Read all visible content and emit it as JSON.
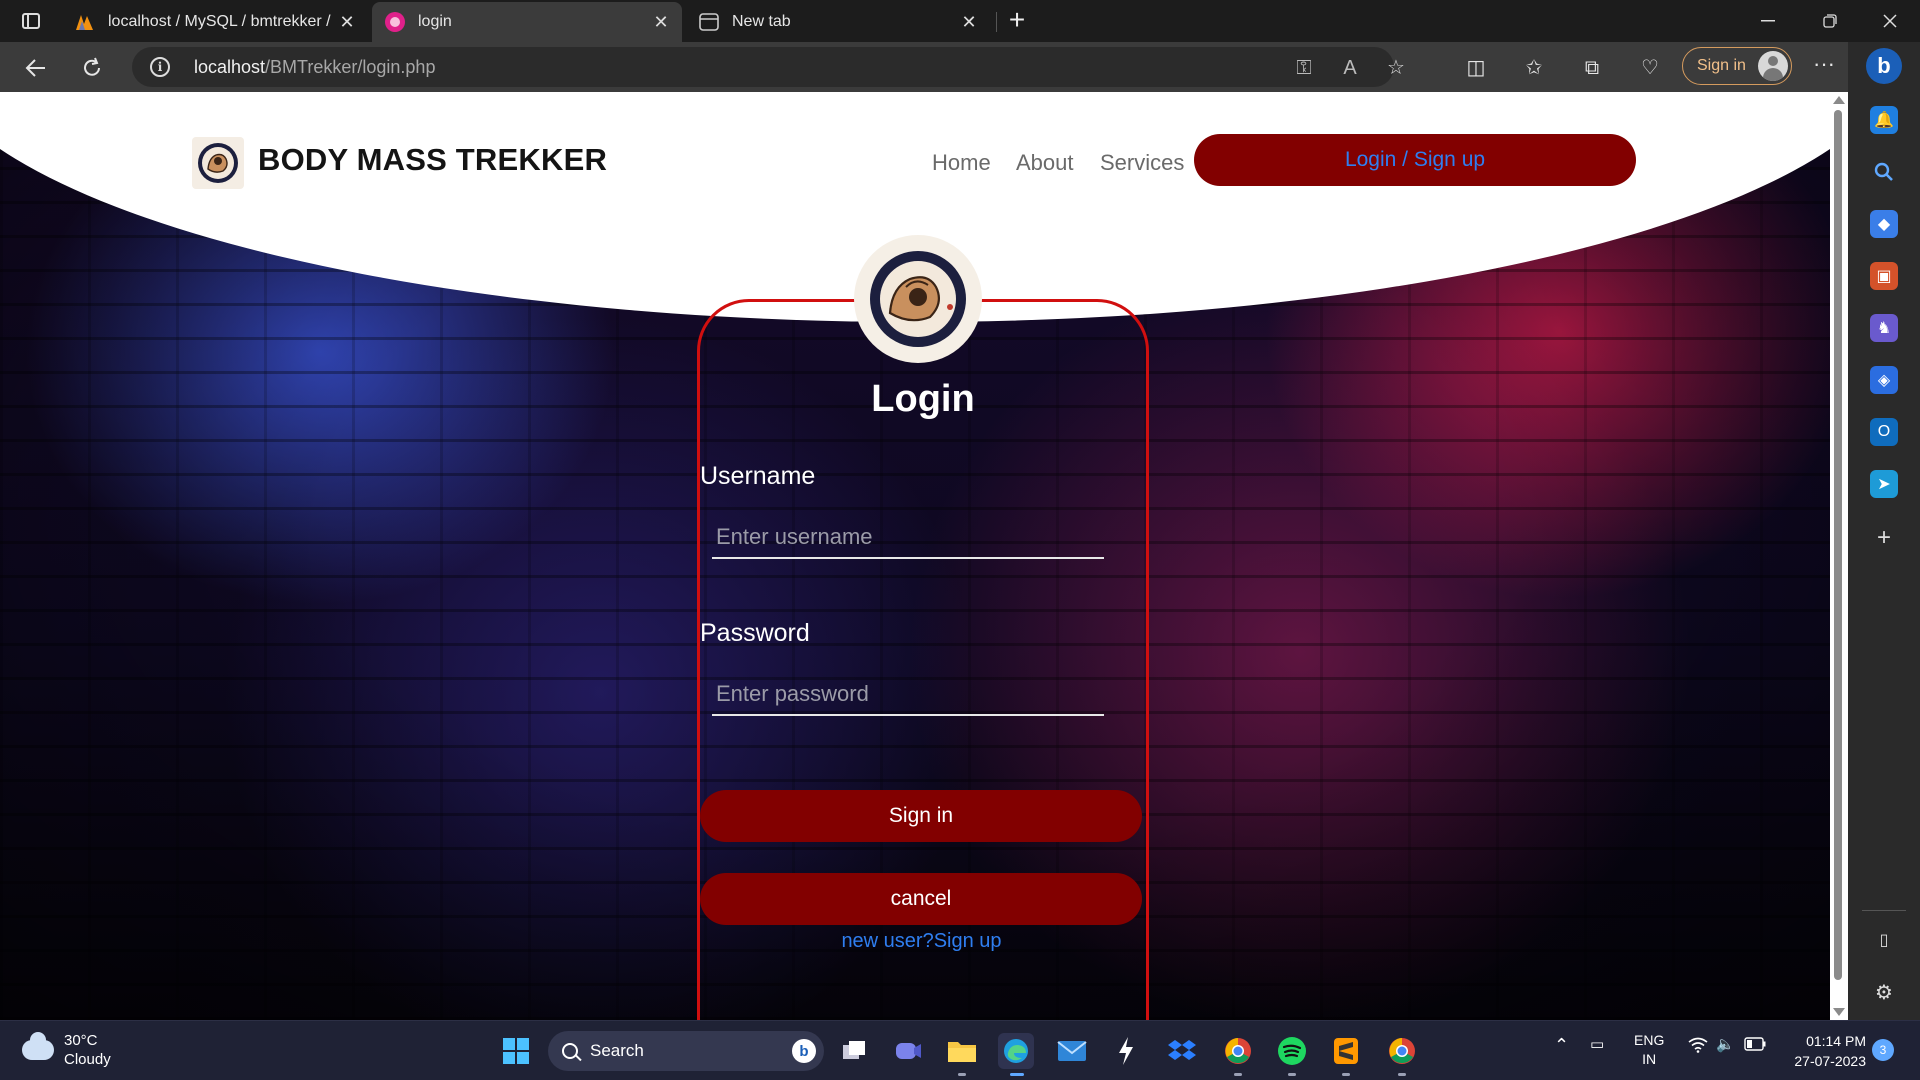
{
  "browser": {
    "tabs": [
      {
        "label": "localhost / MySQL / bmtrekker /",
        "active": false
      },
      {
        "label": "login",
        "active": true
      },
      {
        "label": "New tab",
        "active": false
      }
    ],
    "url_host": "localhost",
    "url_path": "/BMTrekker/login.php",
    "profile_button": "Sign in"
  },
  "site": {
    "brand": "BODY MASS TREKKER",
    "nav": {
      "home": "Home",
      "about": "About",
      "services": "Services",
      "login_signup": "Login / Sign up"
    }
  },
  "login_form": {
    "title": "Login",
    "username_label": "Username",
    "username_placeholder": "Enter username",
    "username_value": "",
    "password_label": "Password",
    "password_placeholder": "Enter password",
    "password_value": "",
    "signin_button": "Sign in",
    "cancel_button": "cancel",
    "signup_link": "new user?Sign up"
  },
  "taskbar": {
    "weather_temp": "30°C",
    "weather_desc": "Cloudy",
    "search_placeholder": "Search",
    "lang_line1": "ENG",
    "lang_line2": "IN",
    "time": "01:14 PM",
    "date": "27-07-2023",
    "notification_count": "3"
  },
  "colors": {
    "accent_red": "#820000",
    "card_border": "#d10f0f",
    "link_blue": "#2f7ef0"
  }
}
